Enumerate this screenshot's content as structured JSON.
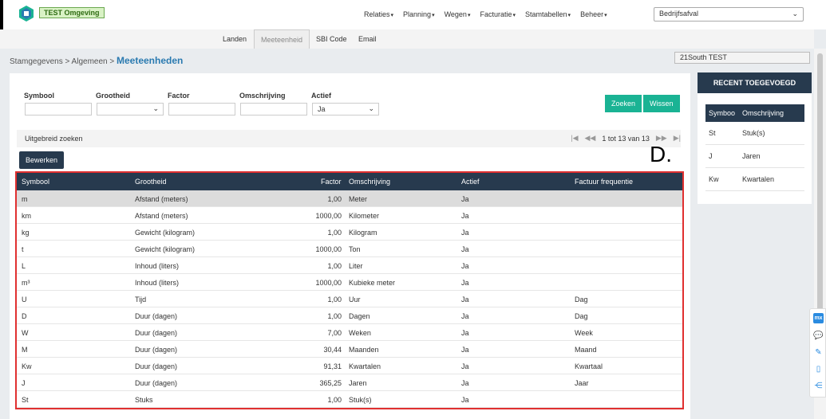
{
  "header": {
    "env_badge": "TEST Omgeving",
    "menu": [
      "Relaties",
      "Planning",
      "Wegen",
      "Facturatie",
      "Stamtabellen",
      "Beheer"
    ],
    "company": "Bedrijfsafval"
  },
  "subnav": {
    "tabs": [
      "Landen",
      "Meeteenheid",
      "SBI Code",
      "Email"
    ],
    "active": "Meeteenheid"
  },
  "breadcrumb": {
    "path": "Stamgegevens > Algemeen > ",
    "current": "Meeteenheden"
  },
  "user": "21South TEST",
  "filters": {
    "symbool_label": "Symbool",
    "grootheid_label": "Grootheid",
    "factor_label": "Factor",
    "omschrijving_label": "Omschrijving",
    "actief_label": "Actief",
    "actief_value": "Ja",
    "search_button": "Zoeken",
    "clear_button": "Wissen"
  },
  "advanced_search": "Uitgebreid zoeken",
  "pager": {
    "text": "1 tot 13 van 13"
  },
  "edit_button": "Bewerken",
  "annotation": "D.",
  "table": {
    "headers": [
      "Symbool",
      "Grootheid",
      "Factor",
      "Omschrijving",
      "Actief",
      "Factuur frequentie"
    ],
    "rows": [
      [
        "m",
        "Afstand (meters)",
        "1,00",
        "Meter",
        "Ja",
        ""
      ],
      [
        "km",
        "Afstand (meters)",
        "1000,00",
        "Kilometer",
        "Ja",
        ""
      ],
      [
        "kg",
        "Gewicht (kilogram)",
        "1,00",
        "Kilogram",
        "Ja",
        ""
      ],
      [
        "t",
        "Gewicht (kilogram)",
        "1000,00",
        "Ton",
        "Ja",
        ""
      ],
      [
        "L",
        "Inhoud (liters)",
        "1,00",
        "Liter",
        "Ja",
        ""
      ],
      [
        "m³",
        "Inhoud (liters)",
        "1000,00",
        "Kubieke meter",
        "Ja",
        ""
      ],
      [
        "U",
        "Tijd",
        "1,00",
        "Uur",
        "Ja",
        "Dag"
      ],
      [
        "D",
        "Duur (dagen)",
        "1,00",
        "Dagen",
        "Ja",
        "Dag"
      ],
      [
        "W",
        "Duur (dagen)",
        "7,00",
        "Weken",
        "Ja",
        "Week"
      ],
      [
        "M",
        "Duur (dagen)",
        "30,44",
        "Maanden",
        "Ja",
        "Maand"
      ],
      [
        "Kw",
        "Duur (dagen)",
        "91,31",
        "Kwartalen",
        "Ja",
        "Kwartaal"
      ],
      [
        "J",
        "Duur (dagen)",
        "365,25",
        "Jaren",
        "Ja",
        "Jaar"
      ],
      [
        "St",
        "Stuks",
        "1,00",
        "Stuk(s)",
        "Ja",
        ""
      ]
    ]
  },
  "recent": {
    "title": "RECENT TOEGEVOEGD",
    "headers": [
      "Symboo",
      "Omschrijving"
    ],
    "rows": [
      [
        "St",
        "Stuk(s)"
      ],
      [
        "J",
        "Jaren"
      ],
      [
        "Kw",
        "Kwartalen"
      ]
    ]
  },
  "floating_bar": {
    "mx_label": "mx"
  }
}
